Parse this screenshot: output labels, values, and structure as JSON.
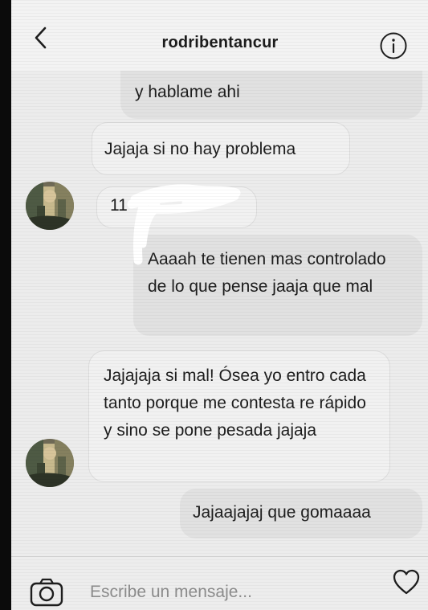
{
  "header": {
    "username": "rodribentancur",
    "back_icon": "chevron-left-icon",
    "info_icon": "info-icon"
  },
  "messages": [
    {
      "sender": "user",
      "text": "y hablame ahi"
    },
    {
      "sender": "user",
      "text": "Jajaja si no hay problema"
    },
    {
      "sender": "contact",
      "text": "11"
    },
    {
      "sender": "user",
      "text": "Aaaah te tienen mas controlado de lo que pense jaaja que mal"
    },
    {
      "sender": "contact",
      "text": "Jajajaja si mal! Ósea yo entro cada tanto porque me contesta re rápido y sino se pone pesada jajaja"
    },
    {
      "sender": "user",
      "text": "Jajaajajaj que gomaaaa"
    }
  ],
  "composer": {
    "placeholder": "Escribe un mensaje...",
    "camera_icon": "camera-icon",
    "heart_icon": "heart-icon"
  },
  "colors": {
    "background": "#ececec",
    "outgoing_bubble": "#e1e1e1",
    "incoming_bubble": "#f1f1f1",
    "text": "#1d1d1d"
  }
}
